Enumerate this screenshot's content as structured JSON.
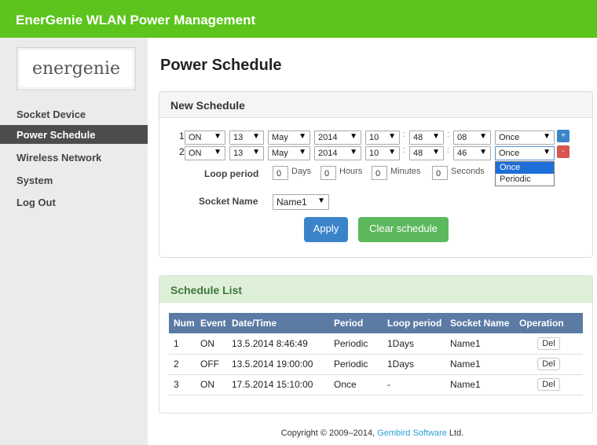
{
  "header": {
    "title": "EnerGenie WLAN Power Management"
  },
  "logo": {
    "text": "energenie"
  },
  "sidebar": {
    "items": [
      {
        "label": "Socket Device",
        "active": false
      },
      {
        "label": "Power Schedule",
        "active": true
      },
      {
        "label": "Wireless Network",
        "active": false
      },
      {
        "label": "System",
        "active": false
      },
      {
        "label": "Log Out",
        "active": false
      }
    ]
  },
  "page": {
    "title": "Power Schedule"
  },
  "new_schedule": {
    "heading": "New Schedule",
    "rows": [
      {
        "num": "1",
        "event": "ON",
        "day": "13",
        "month": "May",
        "year": "2014",
        "hour": "10",
        "minute": "48",
        "second": "08",
        "period": "Once",
        "action": "+"
      },
      {
        "num": "2",
        "event": "ON",
        "day": "13",
        "month": "May",
        "year": "2014",
        "hour": "10",
        "minute": "48",
        "second": "46",
        "period": "Once",
        "action": "-"
      }
    ],
    "period_options": [
      "Once",
      "Periodic"
    ],
    "highlighted_option": "Once",
    "loop_period": {
      "label": "Loop period",
      "days": "0",
      "days_unit": "Days",
      "hours": "0",
      "hours_unit": "Hours",
      "minutes": "0",
      "minutes_unit": "Minutes",
      "seconds": "0",
      "seconds_unit": "Seconds"
    },
    "socket_name": {
      "label": "Socket Name",
      "value": "Name1"
    },
    "apply_label": "Apply",
    "clear_label": "Clear schedule"
  },
  "schedule_list": {
    "heading": "Schedule List",
    "columns": [
      "Num",
      "Event",
      "Date/Time",
      "Period",
      "Loop period",
      "Socket Name",
      "Operation"
    ],
    "rows": [
      {
        "num": "1",
        "event": "ON",
        "datetime": "13.5.2014 8:46:49",
        "period": "Periodic",
        "loop": "1Days",
        "socket": "Name1",
        "op": "Del"
      },
      {
        "num": "2",
        "event": "OFF",
        "datetime": "13.5.2014 19:00:00",
        "period": "Periodic",
        "loop": "1Days",
        "socket": "Name1",
        "op": "Del"
      },
      {
        "num": "3",
        "event": "ON",
        "datetime": "17.5.2014 15:10:00",
        "period": "Once",
        "loop": "-",
        "socket": "Name1",
        "op": "Del"
      }
    ]
  },
  "footer": {
    "prefix": "Copyright © 2009–2014, ",
    "link": "Gembird Software",
    "suffix": " Ltd."
  },
  "colors": {
    "brand_green": "#5cc41c",
    "active_nav": "#4d4d4d",
    "table_header": "#5b7ba5",
    "apply": "#3c84c9",
    "clear": "#5cb85c",
    "add": "#3c84c9",
    "remove": "#d9534f"
  }
}
